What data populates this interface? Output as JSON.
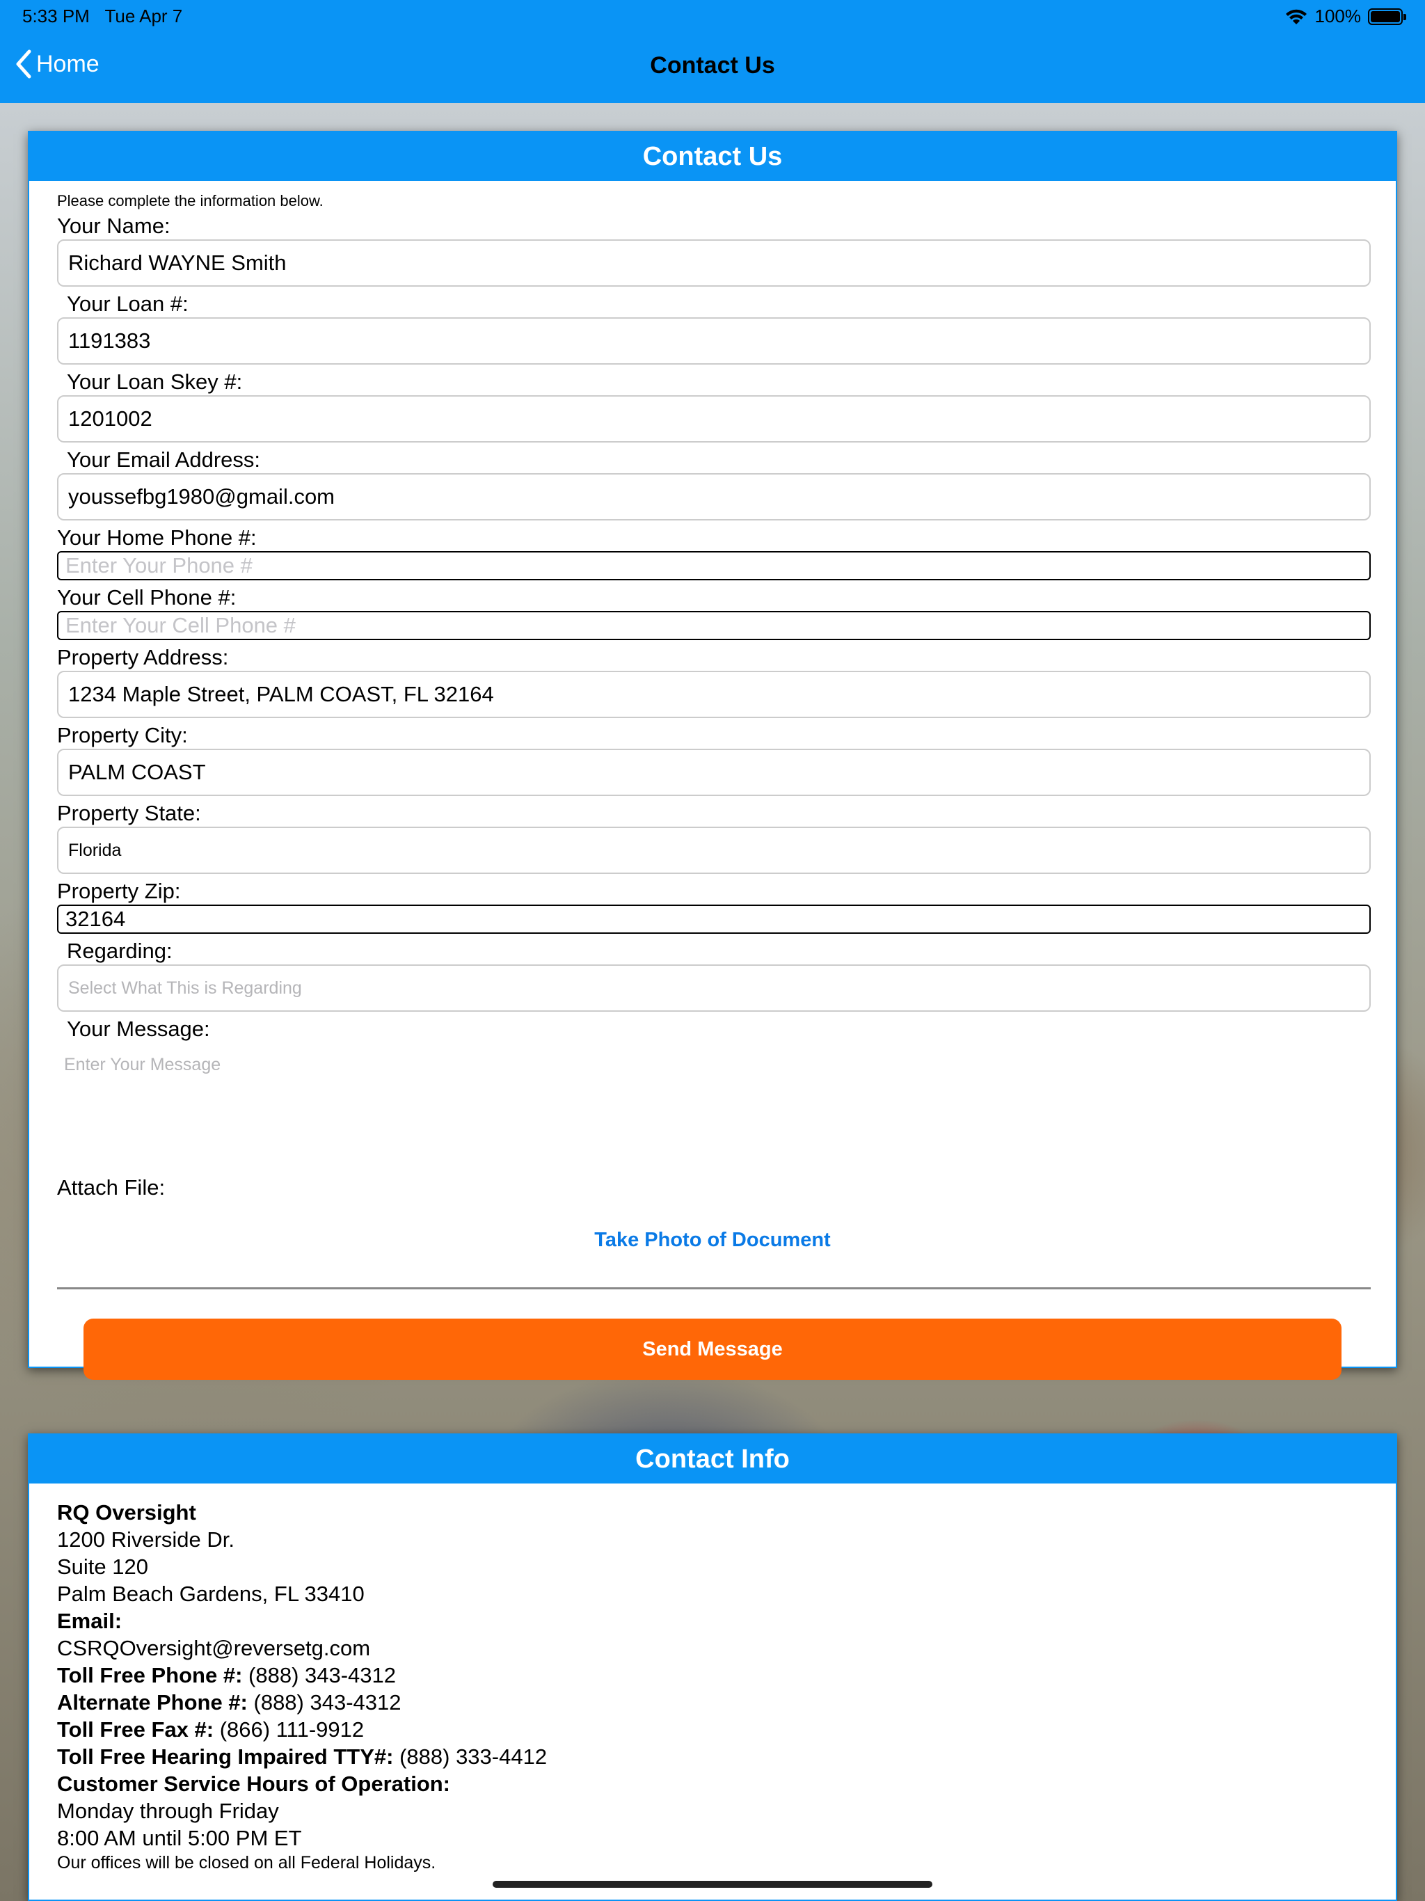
{
  "status_bar": {
    "time": "5:33 PM",
    "date": "Tue Apr 7",
    "battery": "100%"
  },
  "nav": {
    "back_label": "Home",
    "title": "Contact Us"
  },
  "form": {
    "header": "Contact Us",
    "hint": "Please complete the information below.",
    "name_label": "Your Name:",
    "name_value": "Richard WAYNE Smith",
    "loan_label": "Your Loan #:",
    "loan_value": "1191383",
    "skey_label": "Your Loan Skey #:",
    "skey_value": "1201002",
    "email_label": "Your Email Address:",
    "email_value": "youssefbg1980@gmail.com",
    "home_phone_label": "Your Home Phone #:",
    "home_phone_placeholder": "Enter Your Phone #",
    "cell_phone_label": "Your Cell Phone #:",
    "cell_phone_placeholder": "Enter Your Cell Phone #",
    "address_label": "Property Address:",
    "address_value": "1234 Maple Street, PALM COAST, FL 32164",
    "city_label": "Property City:",
    "city_value": "PALM COAST",
    "state_label": "Property State:",
    "state_value": "Florida",
    "zip_label": "Property Zip:",
    "zip_value": "32164",
    "regarding_label": "Regarding:",
    "regarding_placeholder": "Select What This is Regarding",
    "message_label": "Your Message:",
    "message_placeholder": "Enter Your Message",
    "attach_label": "Attach File:",
    "photo_button": "Take Photo of Document",
    "send_button": "Send Message"
  },
  "info": {
    "header": "Contact Info",
    "company": "RQ Oversight",
    "address1": "1200 Riverside Dr.",
    "address2": "Suite 120",
    "address3": "Palm Beach Gardens, FL 33410",
    "email_label": "Email:",
    "email_value": "CSRQOversight@reversetg.com",
    "toll_free_label": "Toll Free Phone #:",
    "toll_free_value": " (888) 343-4312",
    "alt_phone_label": "Alternate Phone #:",
    "alt_phone_value": " (888) 343-4312",
    "fax_label": "Toll Free Fax #:",
    "fax_value": " (866) 111-9912",
    "tty_label": "Toll Free Hearing Impaired TTY#:",
    "tty_value": " (888) 333-4412",
    "hours_label": "Customer Service Hours of Operation:",
    "hours_days": "Monday through Friday",
    "hours_time": "8:00 AM until 5:00 PM ET",
    "holiday_note": "Our offices will be closed on all Federal Holidays."
  },
  "colors": {
    "accent": "#0a94f5",
    "send": "#ff6707",
    "link": "#0a7ae6"
  }
}
